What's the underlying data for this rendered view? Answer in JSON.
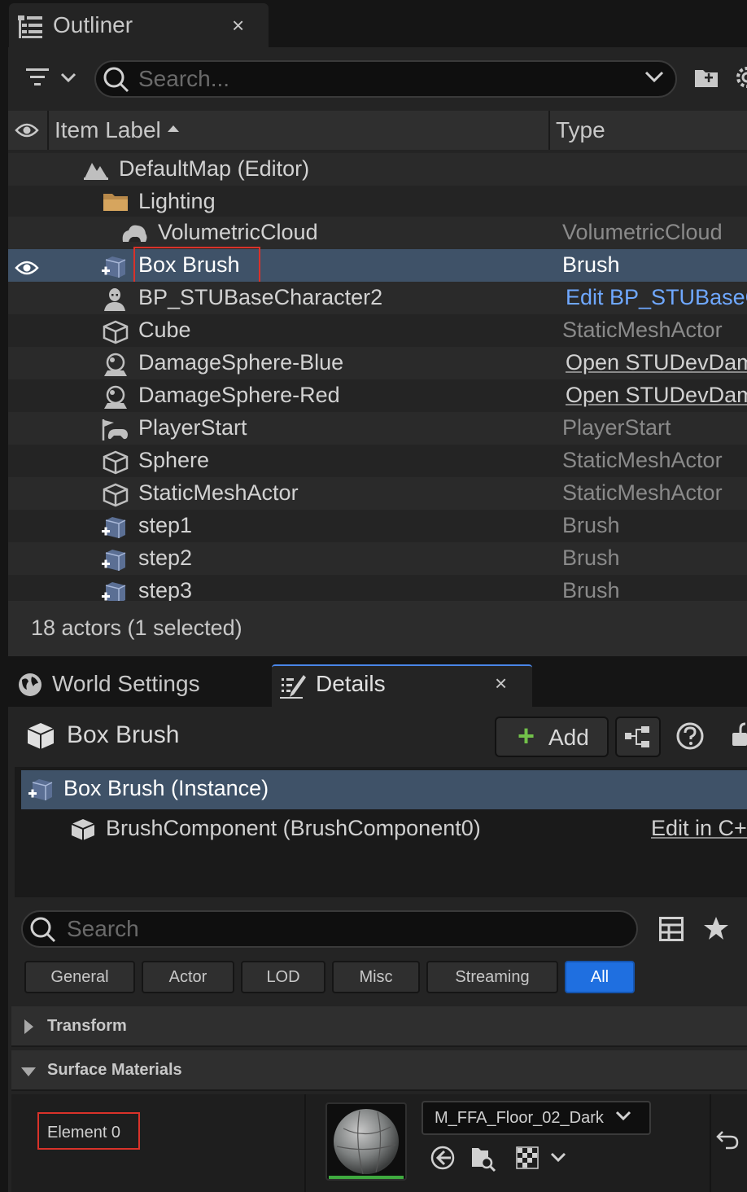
{
  "outliner": {
    "tab_title": "Outliner",
    "close_glyph": "×",
    "search_placeholder": "Search...",
    "columns": {
      "label": "Item Label",
      "type": "Type"
    },
    "rows": [
      {
        "label": "DefaultMap (Editor)",
        "type": "",
        "icon": "map-icon"
      },
      {
        "label": "Lighting",
        "type": "",
        "icon": "folder-icon"
      },
      {
        "label": "VolumetricCloud",
        "type": "VolumetricCloud",
        "icon": "cloud-icon"
      },
      {
        "label": "Box Brush",
        "type": "Brush",
        "icon": "brush-icon",
        "selected": true
      },
      {
        "label": "BP_STUBaseCharacter2",
        "type": "Edit BP_STUBaseC",
        "icon": "character-icon"
      },
      {
        "label": "Cube",
        "type": "StaticMeshActor",
        "icon": "static-mesh-icon"
      },
      {
        "label": "DamageSphere-Blue",
        "type": "Open STUDevDam",
        "icon": "actor-icon"
      },
      {
        "label": "DamageSphere-Red",
        "type": "Open STUDevDam",
        "icon": "actor-icon"
      },
      {
        "label": "PlayerStart",
        "type": "PlayerStart",
        "icon": "player-start-icon"
      },
      {
        "label": "Sphere",
        "type": "StaticMeshActor",
        "icon": "static-mesh-icon"
      },
      {
        "label": "StaticMeshActor",
        "type": "StaticMeshActor",
        "icon": "static-mesh-icon"
      },
      {
        "label": "step1",
        "type": "Brush",
        "icon": "brush-icon"
      },
      {
        "label": "step2",
        "type": "Brush",
        "icon": "brush-icon"
      },
      {
        "label": "step3",
        "type": "Brush",
        "icon": "brush-icon"
      }
    ],
    "status": "18 actors (1 selected)"
  },
  "tabs": {
    "world_settings": "World Settings",
    "details": "Details"
  },
  "details": {
    "actor_name": "Box Brush",
    "add_label": "Add",
    "plus_glyph": "+",
    "components": {
      "root": "Box Brush (Instance)",
      "child": "BrushComponent (BrushComponent0)",
      "edit_link": "Edit in C++"
    },
    "search_placeholder": "Search",
    "filters": [
      "General",
      "Actor",
      "LOD",
      "Misc",
      "Streaming",
      "All"
    ],
    "active_filter": "All",
    "sections": {
      "transform": "Transform",
      "surface_materials": "Surface Materials"
    },
    "element_label": "Element 0",
    "material_name": "M_FFA_Floor_02_Dark"
  },
  "colors": {
    "selection": "#3f5268",
    "accent_blue": "#1f6fe0",
    "add_green": "#72c14a",
    "highlight_red": "#d9322a",
    "link_blue": "#6fa8ff"
  }
}
